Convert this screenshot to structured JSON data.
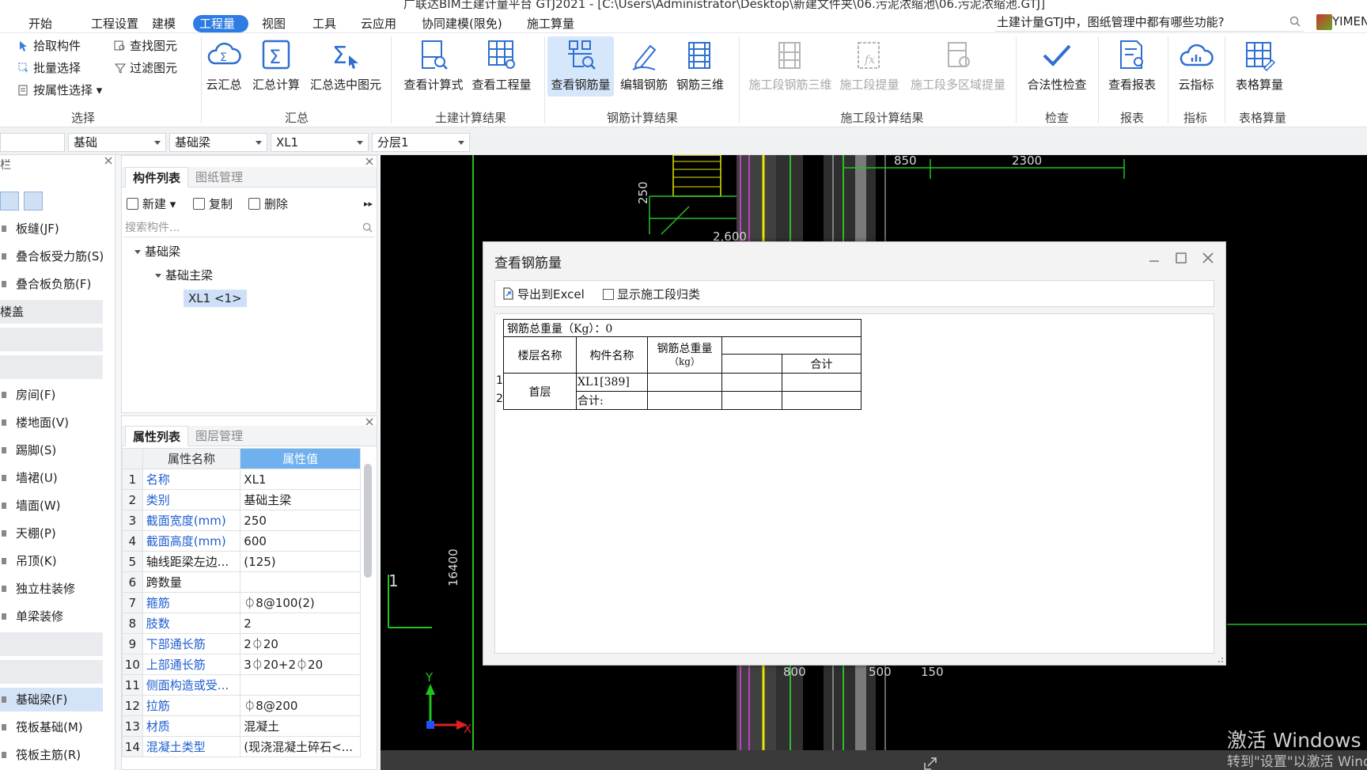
{
  "window": {
    "title": "广联达BIM土建计量平台 GTJ2021 - [C:\\Users\\Administrator\\Desktop\\新建文件夹\\06.污泥浓缩池\\06.污泥浓缩池.GTJ]"
  },
  "menu": {
    "items": [
      "开始",
      "工程设置",
      "建模",
      "工程量",
      "视图",
      "工具",
      "云应用",
      "协同建模(限免)",
      "施工算量"
    ],
    "active": "工程量"
  },
  "qa": {
    "text": "土建计量GTJ中，图纸管理中都有哪些功能?"
  },
  "user": {
    "name": "YIMEN"
  },
  "ribbon": {
    "select": {
      "label": "选择",
      "items": [
        "拾取构件",
        "批量选择",
        "按属性选择",
        "查找图元",
        "过滤图元"
      ]
    },
    "summary": {
      "label": "汇总",
      "items": [
        "云汇总",
        "汇总计算",
        "汇总选中图元"
      ]
    },
    "civil": {
      "label": "土建计算结果",
      "items": [
        "查看计算式",
        "查看工程量"
      ]
    },
    "rebar": {
      "label": "钢筋计算结果",
      "items": [
        "查看钢筋量",
        "编辑钢筋",
        "钢筋三维"
      ]
    },
    "stage": {
      "label": "施工段计算结果",
      "items": [
        "施工段钢筋三维",
        "施工段提量",
        "施工段多区域提量"
      ]
    },
    "check": {
      "label": "检查",
      "items": [
        "合法性检查"
      ]
    },
    "report": {
      "label": "报表",
      "items": [
        "查看报表"
      ]
    },
    "index": {
      "label": "指标",
      "items": [
        "云指标"
      ]
    },
    "table": {
      "label": "表格算量",
      "items": [
        "表格算量"
      ]
    }
  },
  "filters": [
    "",
    "基础",
    "基础梁",
    "XL1",
    "分层1"
  ],
  "leftnav": {
    "header": "栏",
    "items": [
      {
        "label": "板缝(JF)",
        "type": "item"
      },
      {
        "label": "叠合板受力筋(S)",
        "type": "item"
      },
      {
        "label": "叠合板负筋(F)",
        "type": "item"
      },
      {
        "label": "楼盖",
        "type": "group"
      },
      {
        "label": "",
        "type": "group"
      },
      {
        "label": "",
        "type": "group"
      },
      {
        "label": "房间(F)",
        "type": "item"
      },
      {
        "label": "楼地面(V)",
        "type": "item"
      },
      {
        "label": "踢脚(S)",
        "type": "item"
      },
      {
        "label": "墙裙(U)",
        "type": "item"
      },
      {
        "label": "墙面(W)",
        "type": "item"
      },
      {
        "label": "天棚(P)",
        "type": "item"
      },
      {
        "label": "吊顶(K)",
        "type": "item"
      },
      {
        "label": "独立柱装修",
        "type": "item"
      },
      {
        "label": "单梁装修",
        "type": "item"
      },
      {
        "label": "",
        "type": "group"
      },
      {
        "label": "",
        "type": "group"
      },
      {
        "label": "基础梁(F)",
        "type": "selected"
      },
      {
        "label": "筏板基础(M)",
        "type": "item"
      },
      {
        "label": "筏板主筋(R)",
        "type": "item"
      }
    ]
  },
  "complist": {
    "tabs": [
      "构件列表",
      "图纸管理"
    ],
    "tools": [
      "新建",
      "复制",
      "删除"
    ],
    "search_placeholder": "搜索构件...",
    "tree": {
      "root": "基础梁",
      "child": "基础主梁",
      "leaf": "XL1 <1>"
    }
  },
  "proppanel": {
    "tabs": [
      "属性列表",
      "图层管理"
    ],
    "col_name": "属性名称",
    "col_value": "属性值",
    "rows": [
      {
        "no": "1",
        "name": "名称",
        "value": "XL1",
        "link": true
      },
      {
        "no": "2",
        "name": "类别",
        "value": "基础主梁",
        "link": true
      },
      {
        "no": "3",
        "name": "截面宽度(mm)",
        "value": "250",
        "link": true
      },
      {
        "no": "4",
        "name": "截面高度(mm)",
        "value": "600",
        "link": true
      },
      {
        "no": "5",
        "name": "轴线距梁左边...",
        "value": "(125)",
        "link": false
      },
      {
        "no": "6",
        "name": "跨数量",
        "value": "",
        "link": false
      },
      {
        "no": "7",
        "name": "箍筋",
        "value": "⏀8@100(2)",
        "link": true
      },
      {
        "no": "8",
        "name": "肢数",
        "value": "2",
        "link": true
      },
      {
        "no": "9",
        "name": "下部通长筋",
        "value": "2⏀20",
        "link": true
      },
      {
        "no": "10",
        "name": "上部通长筋",
        "value": "3⏀20+2⏀20",
        "link": true
      },
      {
        "no": "11",
        "name": "侧面构造或受...",
        "value": "",
        "link": true
      },
      {
        "no": "12",
        "name": "拉筋",
        "value": "⏀8@200",
        "link": true
      },
      {
        "no": "13",
        "name": "材质",
        "value": "混凝土",
        "link": true
      },
      {
        "no": "14",
        "name": "混凝土类型",
        "value": "(现浇混凝土碎石<...",
        "link": true
      }
    ]
  },
  "cad": {
    "dims": [
      "850",
      "2300",
      "250",
      "2,600",
      "16400",
      "800",
      "500",
      "150",
      "1"
    ],
    "axis_x": "X",
    "axis_y": "Y"
  },
  "dialog": {
    "title": "查看钢筋量",
    "export": "导出到Excel",
    "show_stage": "显示施工段归类",
    "total": "钢筋总重量（Kg）：0",
    "col_floor": "楼层名称",
    "col_name": "构件名称",
    "col_weight": "钢筋总重量",
    "col_weight_unit": "（kg）",
    "col_sum": "合计",
    "row_nums": [
      "1",
      "2"
    ],
    "floor": "首层",
    "component": "XL1[389]",
    "subtotal": "合计:"
  },
  "activation": {
    "title": "激活 Windows",
    "subtitle": "转到\"设置\"以激活 Windows。"
  }
}
